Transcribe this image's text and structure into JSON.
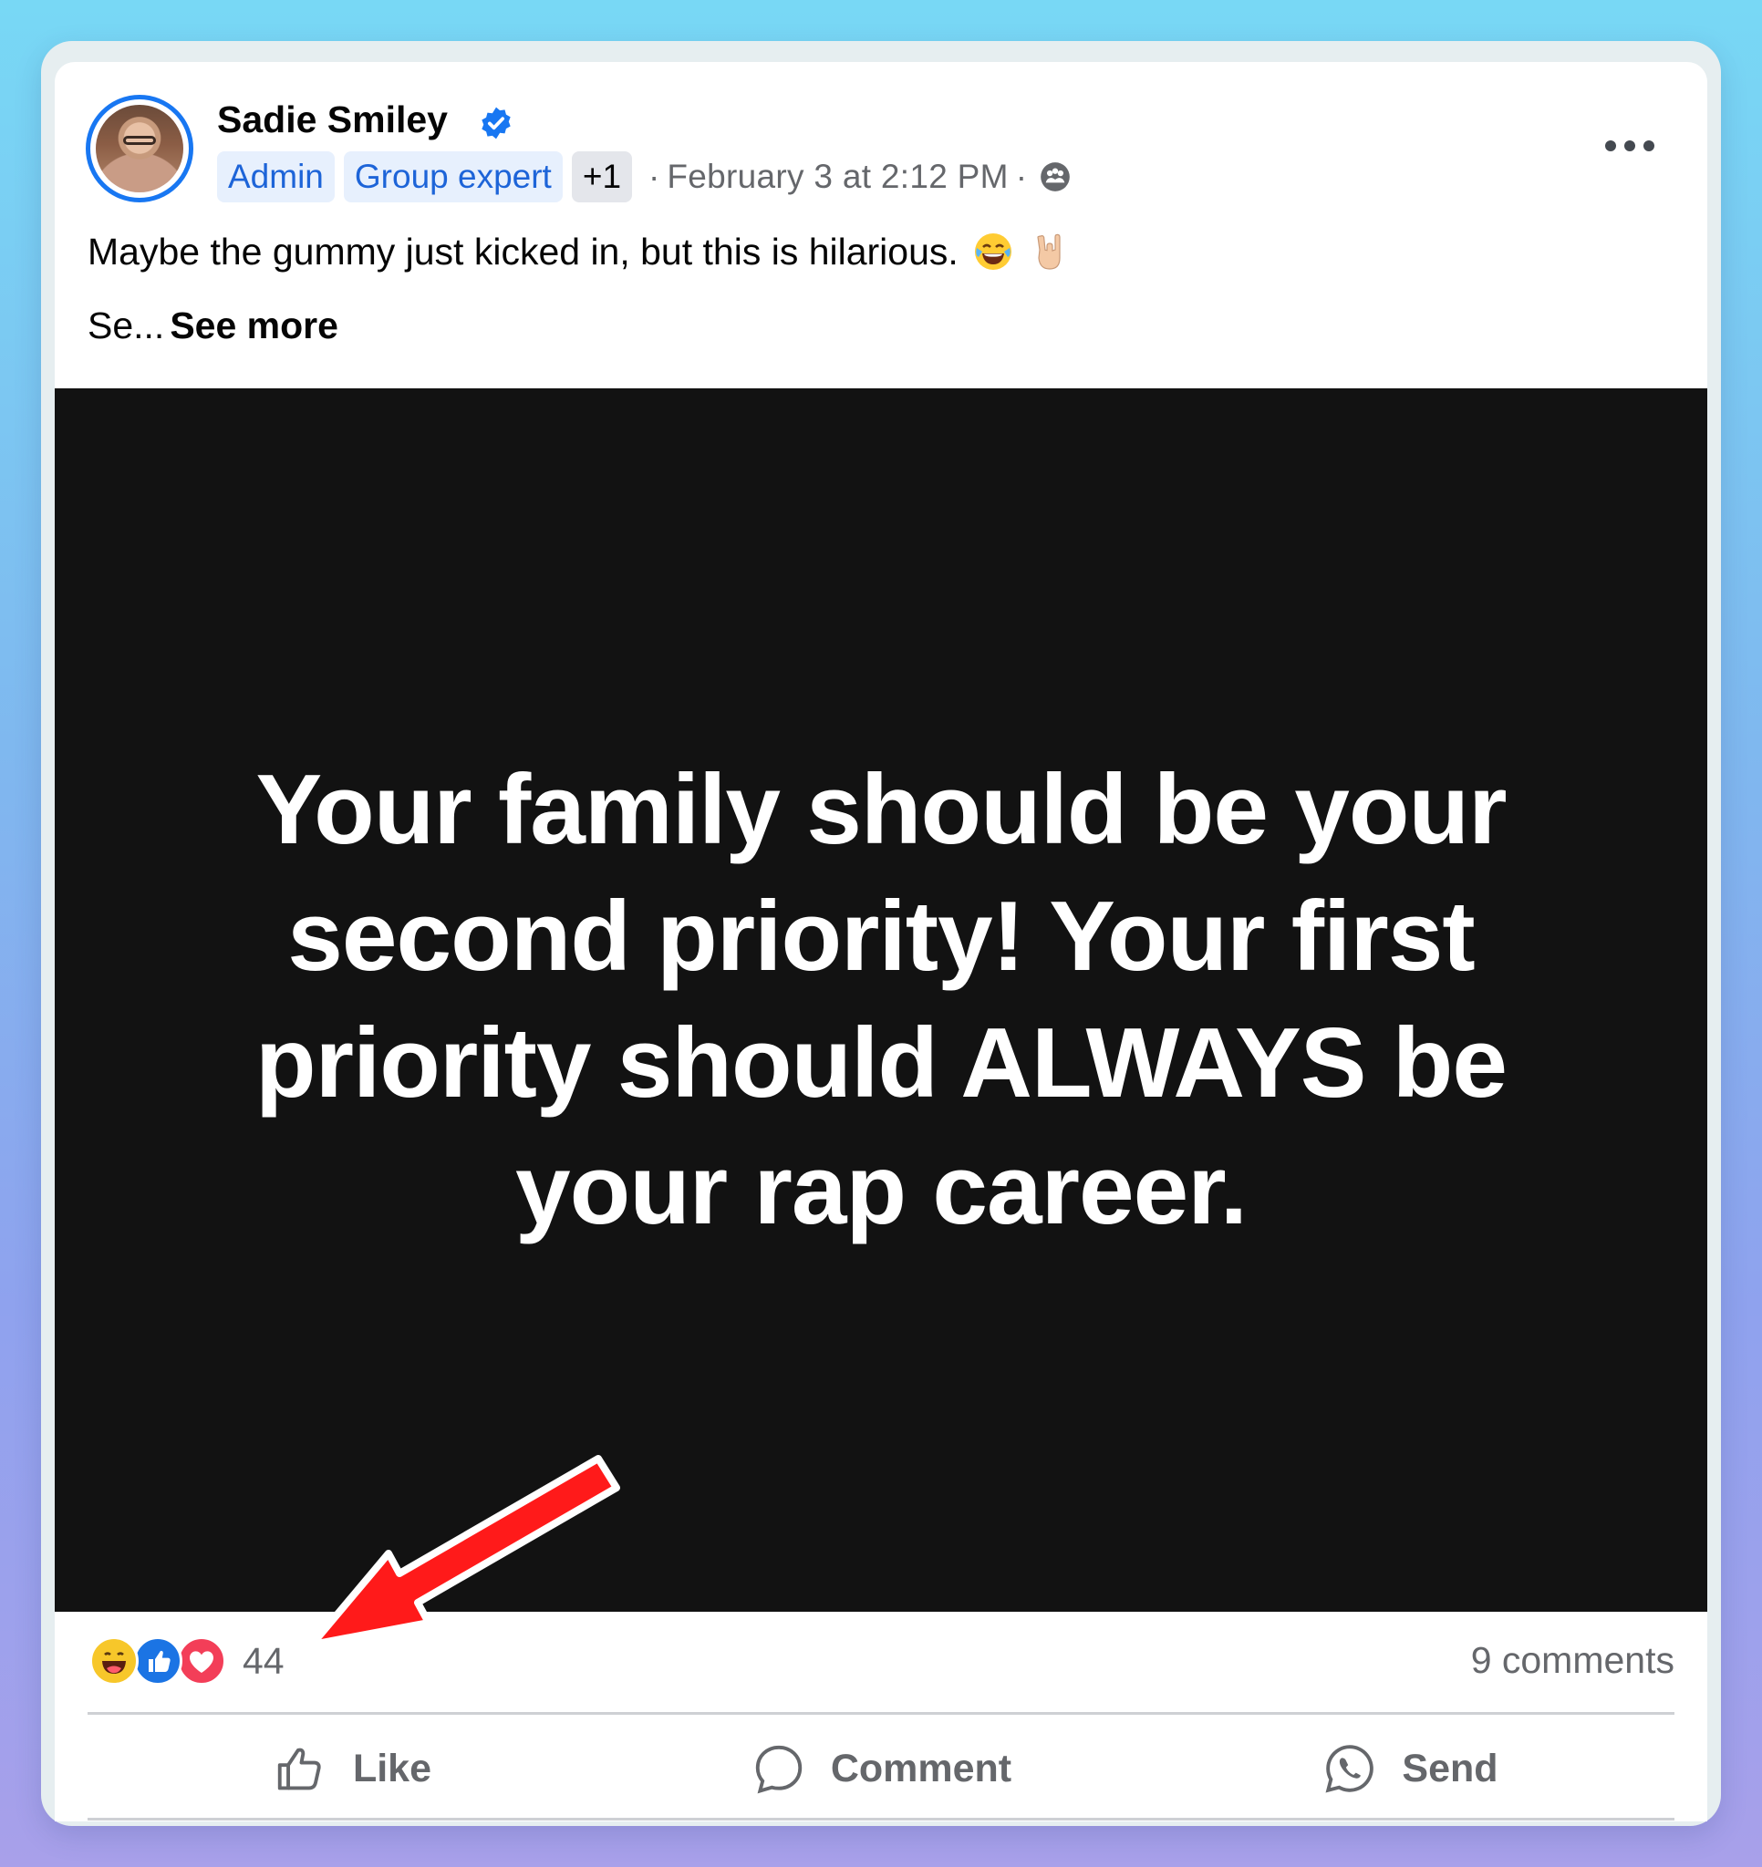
{
  "post": {
    "author": "Sadie Smiley",
    "badges": [
      "Admin",
      "Group expert"
    ],
    "badge_more": "+1",
    "timestamp": "February 3 at 2:12 PM",
    "separator": "·",
    "privacy_icon": "group-audience-icon",
    "text": "Maybe the gummy just kicked in, but this is hilarious.",
    "text_emojis": [
      "tears-of-joy-emoji",
      "rock-on-hand-emoji"
    ],
    "truncated_text": "Se...",
    "see_more": "See more",
    "image_text": "Your family should be your second priority! Your first priority should ALWAYS be your rap career."
  },
  "footer": {
    "reaction_icons": [
      "haha-icon",
      "like-icon",
      "love-icon"
    ],
    "reaction_count": "44",
    "comments_count": "9 comments",
    "actions": [
      "Like",
      "Comment",
      "Send"
    ]
  },
  "colors": {
    "accent": "#1877f2",
    "badge_bg": "#e7f0fd",
    "annotation_arrow": "#ff1a1a",
    "image_bg": "#121212"
  }
}
